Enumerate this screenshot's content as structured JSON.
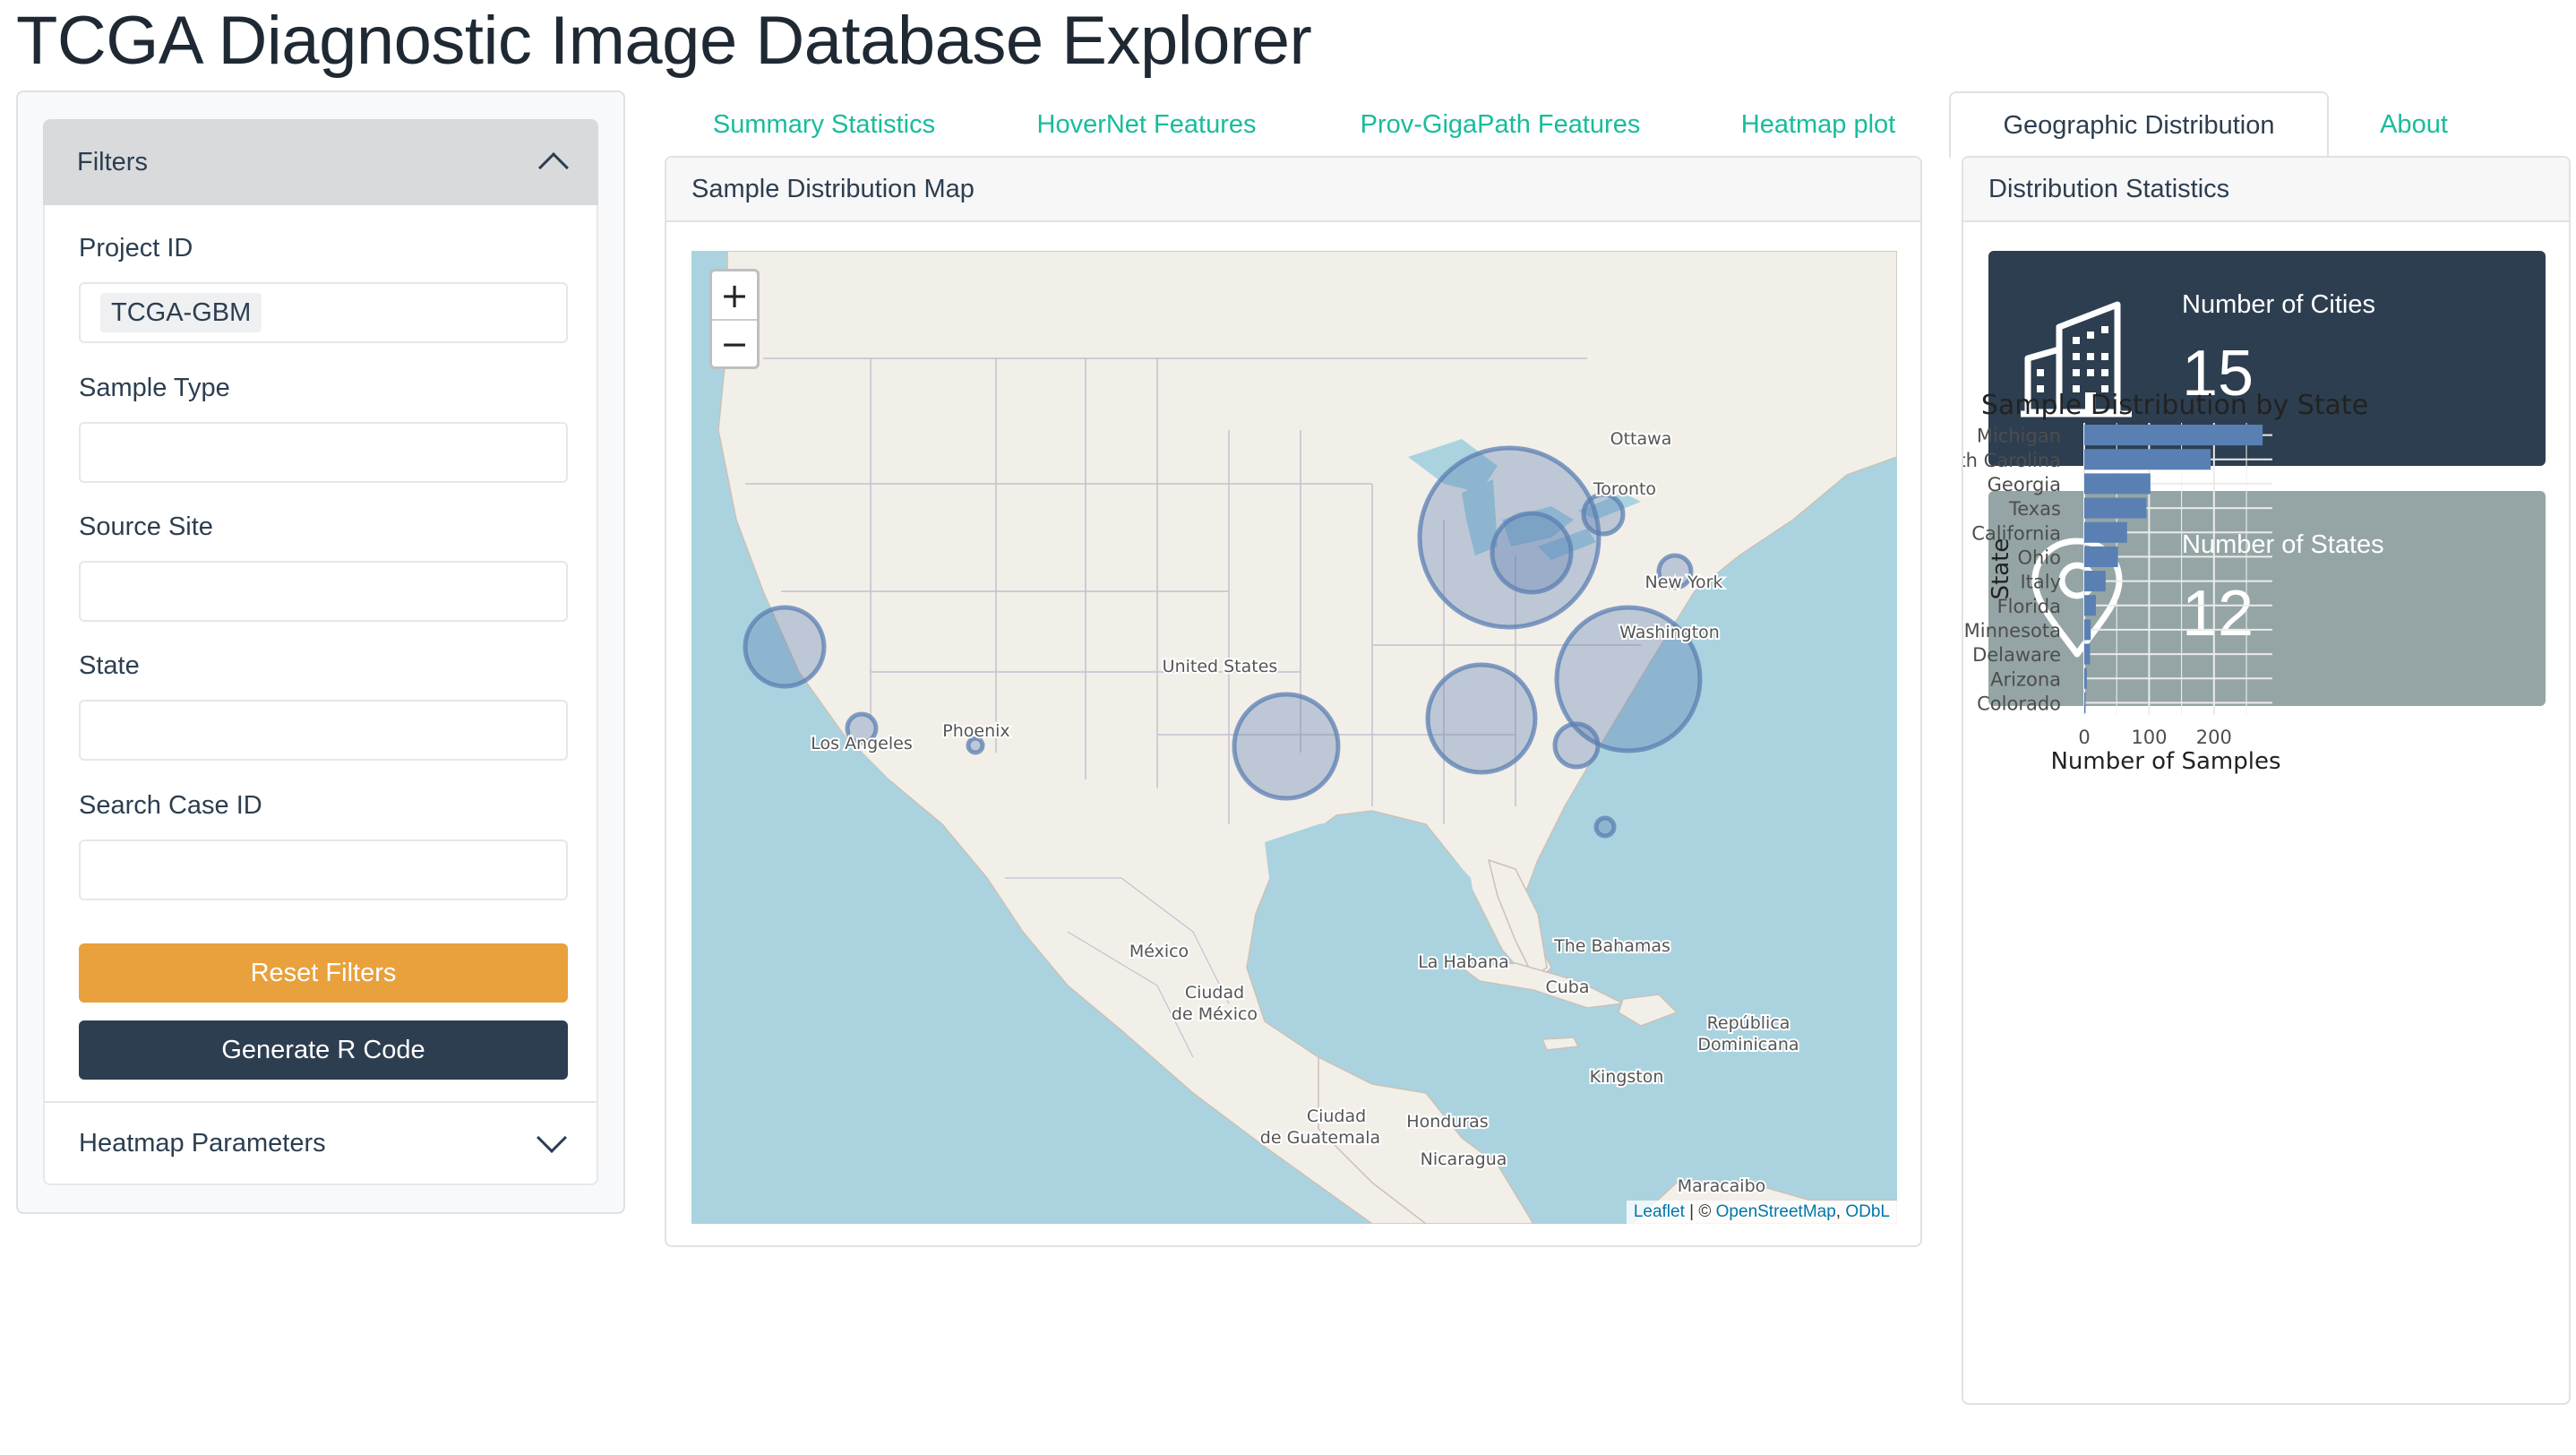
{
  "app": {
    "title": "TCGA Diagnostic Image Database Explorer"
  },
  "sidebar": {
    "filters_header": "Filters",
    "fields": {
      "project_id": {
        "label": "Project ID",
        "value": "TCGA-GBM"
      },
      "sample_type": {
        "label": "Sample Type",
        "value": ""
      },
      "source_site": {
        "label": "Source Site",
        "value": ""
      },
      "state": {
        "label": "State",
        "value": ""
      },
      "search_case": {
        "label": "Search Case ID",
        "value": ""
      }
    },
    "reset_button": "Reset Filters",
    "generate_button": "Generate R Code",
    "heatmap_params": "Heatmap Parameters"
  },
  "tabs": [
    {
      "label": "Summary Statistics",
      "active": false
    },
    {
      "label": "HoverNet Features",
      "active": false
    },
    {
      "label": "Prov-GigaPath Features",
      "active": false
    },
    {
      "label": "Heatmap plot",
      "active": false
    },
    {
      "label": "Geographic Distribution",
      "active": true
    },
    {
      "label": "About",
      "active": false
    }
  ],
  "map": {
    "title": "Sample Distribution Map",
    "zoom_in": "+",
    "zoom_out": "−",
    "attribution": {
      "leaflet": "Leaflet",
      "sep": " | © ",
      "osm": "OpenStreetMap",
      "comma": ", ",
      "odbl": "ODbL"
    },
    "place_labels": {
      "ottawa": "Ottawa",
      "toronto": "Toronto",
      "new_york": "New York",
      "washington": "Washington",
      "united_states": "United States",
      "phoenix": "Phoenix",
      "los_angeles": "Los Angeles",
      "mexico": "México",
      "ciudad_mexico": "Ciudad de México",
      "la_habana": "La Habana",
      "bahamas": "The Bahamas",
      "cuba": "Cuba",
      "rep_dom": "República Dominicana",
      "kingston": "Kingston",
      "ciudad_guatemala": "Ciudad de Guatemala",
      "honduras": "Honduras",
      "nicaragua": "Nicaragua",
      "maracaibo": "Maracaibo"
    },
    "marker_color": "#5b7fb1"
  },
  "stats": {
    "title": "Distribution Statistics",
    "cities": {
      "label": "Number of Cities",
      "value": "15",
      "icon": "building-icon",
      "color": "#2d3e50"
    },
    "states": {
      "label": "Number of States",
      "value": "12",
      "icon": "map-pin-icon",
      "color": "#95a5a6"
    }
  },
  "chart_data": {
    "type": "bar",
    "orientation": "horizontal",
    "title": "Sample Distribution by State",
    "xlabel": "Number of Samples",
    "ylabel": "State",
    "categories": [
      "Michigan",
      "North Carolina",
      "Georgia",
      "Texas",
      "California",
      "Ohio",
      "Italy",
      "Florida",
      "Minnesota",
      "Delaware",
      "Arizona",
      "Colorado"
    ],
    "values": [
      275,
      195,
      102,
      96,
      66,
      52,
      33,
      18,
      10,
      9,
      4,
      2
    ],
    "xlim": [
      0,
      290
    ],
    "xticks": [
      0,
      100,
      200
    ],
    "bar_color": "#5a80b3",
    "grid": true
  }
}
